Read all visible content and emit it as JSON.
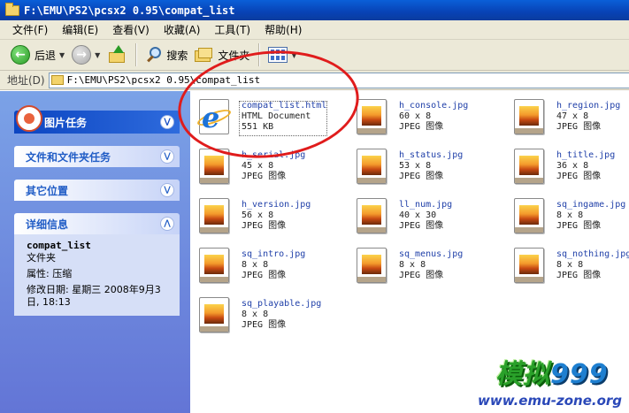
{
  "window": {
    "title": "F:\\EMU\\PS2\\pcsx2 0.95\\compat_list"
  },
  "menubar": [
    {
      "label": "文件(F)"
    },
    {
      "label": "编辑(E)"
    },
    {
      "label": "查看(V)"
    },
    {
      "label": "收藏(A)"
    },
    {
      "label": "工具(T)"
    },
    {
      "label": "帮助(H)"
    }
  ],
  "toolbar": {
    "back_label": "后退",
    "search_label": "搜索",
    "folders_label": "文件夹"
  },
  "address": {
    "label": "地址(D)",
    "path": "F:\\EMU\\PS2\\pcsx2 0.95\\compat_list"
  },
  "sidebar": {
    "picture_tasks": "图片任务",
    "file_folder_tasks": "文件和文件夹任务",
    "other_places": "其它位置",
    "details": {
      "header": "详细信息",
      "name": "compat_list",
      "type": "文件夹",
      "attributes": "属性: 压缩",
      "modified": "修改日期: 星期三 2008年9月3日, 18:13"
    }
  },
  "files": [
    {
      "name": "compat_list.html",
      "dim": "HTML Document",
      "type": "551 KB",
      "icon": "html"
    },
    {
      "name": "h_console.jpg",
      "dim": "60 x 8",
      "type": "JPEG 图像",
      "icon": "jpg"
    },
    {
      "name": "h_region.jpg",
      "dim": "47 x 8",
      "type": "JPEG 图像",
      "icon": "jpg"
    },
    {
      "name": "h_serial.jpg",
      "dim": "45 x 8",
      "type": "JPEG 图像",
      "icon": "jpg"
    },
    {
      "name": "h_status.jpg",
      "dim": "53 x 8",
      "type": "JPEG 图像",
      "icon": "jpg"
    },
    {
      "name": "h_title.jpg",
      "dim": "36 x 8",
      "type": "JPEG 图像",
      "icon": "jpg"
    },
    {
      "name": "h_version.jpg",
      "dim": "56 x 8",
      "type": "JPEG 图像",
      "icon": "jpg"
    },
    {
      "name": "ll_num.jpg",
      "dim": "40 x 30",
      "type": "JPEG 图像",
      "icon": "jpg"
    },
    {
      "name": "sq_ingame.jpg",
      "dim": "8 x 8",
      "type": "JPEG 图像",
      "icon": "jpg"
    },
    {
      "name": "sq_intro.jpg",
      "dim": "8 x 8",
      "type": "JPEG 图像",
      "icon": "jpg"
    },
    {
      "name": "sq_menus.jpg",
      "dim": "8 x 8",
      "type": "JPEG 图像",
      "icon": "jpg"
    },
    {
      "name": "sq_nothing.jpg",
      "dim": "8 x 8",
      "type": "JPEG 图像",
      "icon": "jpg"
    },
    {
      "name": "sq_playable.jpg",
      "dim": "8 x 8",
      "type": "JPEG 图像",
      "icon": "jpg"
    }
  ],
  "watermark": {
    "logo_text": "模拟",
    "logo_nums": "999",
    "url": "www.emu-zone.org"
  }
}
